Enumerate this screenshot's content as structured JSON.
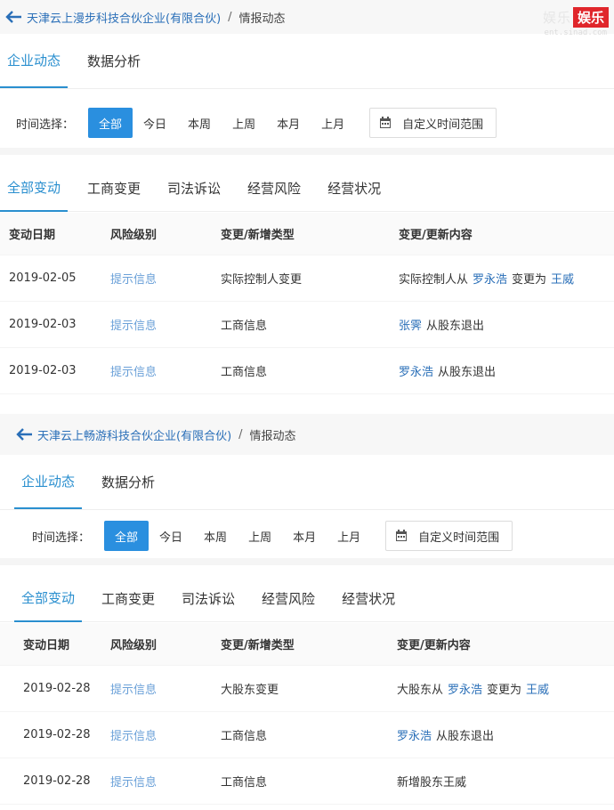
{
  "watermark": {
    "ghost_text": "娱乐",
    "badge_text": "娱乐",
    "sub_text": "ent.sinad.com"
  },
  "panels": [
    {
      "breadcrumb": {
        "company": "天津云上漫步科技合伙企业(有限合伙)",
        "separator": "/",
        "current": "情报动态"
      },
      "main_tabs": [
        "企业动态",
        "数据分析"
      ],
      "time": {
        "label": "时间选择：",
        "options": [
          "全部",
          "今日",
          "本周",
          "上周",
          "本月",
          "上月"
        ],
        "custom_range": "自定义时间范围"
      },
      "sub_tabs": [
        "全部变动",
        "工商变更",
        "司法诉讼",
        "经营风险",
        "经营状况"
      ],
      "table": {
        "headers": [
          "变动日期",
          "风险级别",
          "变更/新增类型",
          "变更/更新内容"
        ],
        "rows": [
          {
            "date": "2019-02-05",
            "level": "提示信息",
            "type": "实际控制人变更",
            "c1": "实际控制人从",
            "p1": "罗永浩",
            "c2": "变更为",
            "p2": "王威",
            "c3": ""
          },
          {
            "date": "2019-02-03",
            "level": "提示信息",
            "type": "工商信息",
            "c1": "",
            "p1": "张霁",
            "c2": "从股东退出",
            "p2": "",
            "c3": ""
          },
          {
            "date": "2019-02-03",
            "level": "提示信息",
            "type": "工商信息",
            "c1": "",
            "p1": "罗永浩",
            "c2": "从股东退出",
            "p2": "",
            "c3": ""
          }
        ]
      }
    },
    {
      "breadcrumb": {
        "company": "天津云上畅游科技合伙企业(有限合伙)",
        "separator": "/",
        "current": "情报动态"
      },
      "main_tabs": [
        "企业动态",
        "数据分析"
      ],
      "time": {
        "label": "时间选择：",
        "options": [
          "全部",
          "今日",
          "本周",
          "上周",
          "本月",
          "上月"
        ],
        "custom_range": "自定义时间范围"
      },
      "sub_tabs": [
        "全部变动",
        "工商变更",
        "司法诉讼",
        "经营风险",
        "经营状况"
      ],
      "table": {
        "headers": [
          "变动日期",
          "风险级别",
          "变更/新增类型",
          "变更/更新内容"
        ],
        "rows": [
          {
            "date": "2019-02-28",
            "level": "提示信息",
            "type": "大股东变更",
            "c1": "大股东从",
            "p1": "罗永浩",
            "c2": "变更为",
            "p2": "王威",
            "c3": ""
          },
          {
            "date": "2019-02-28",
            "level": "提示信息",
            "type": "工商信息",
            "c1": "",
            "p1": "罗永浩",
            "c2": "从股东退出",
            "p2": "",
            "c3": ""
          },
          {
            "date": "2019-02-28",
            "level": "提示信息",
            "type": "工商信息",
            "c1": "新增股东王威",
            "p1": "",
            "c2": "",
            "p2": "",
            "c3": ""
          }
        ]
      }
    }
  ],
  "colors": {
    "accent": "#2a8fcf",
    "link": "#2a6fb8",
    "level": "#6aa0d8",
    "badge": "#e0262b"
  }
}
